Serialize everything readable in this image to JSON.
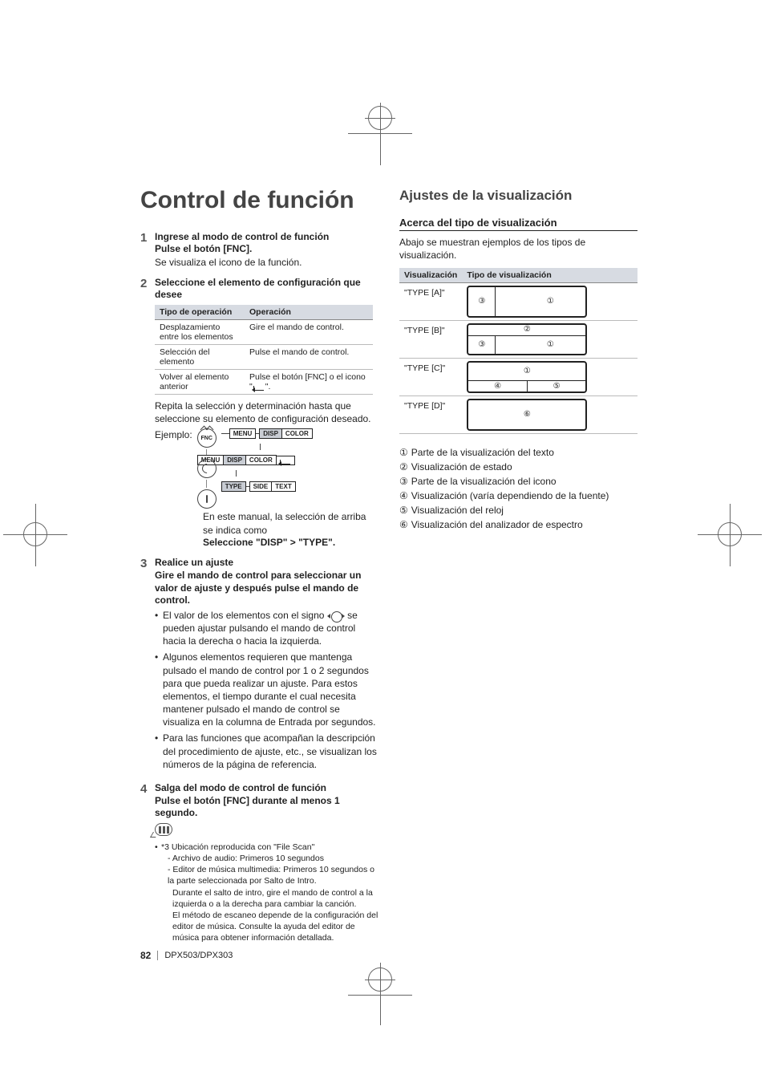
{
  "title": "Control de función",
  "steps": {
    "s1": {
      "num": "1",
      "title": "Ingrese al modo de control de función",
      "sub": "Pulse el botón [FNC].",
      "text": "Se visualiza el icono de la función."
    },
    "s2": {
      "num": "2",
      "title": "Seleccione el elemento de configuración que desee"
    },
    "s3": {
      "num": "3",
      "title": "Realice un ajuste",
      "sub": "Gire el mando de control para seleccionar un valor de ajuste y después pulse el mando de control."
    },
    "s4": {
      "num": "4",
      "title": "Salga del modo de control de función",
      "sub": "Pulse el botón [FNC] durante al menos 1 segundo."
    }
  },
  "op_table": {
    "h1": "Tipo de operación",
    "h2": "Operación",
    "rows": [
      {
        "a": "Desplazamiento entre los elementos",
        "b": "Gire el mando de control."
      },
      {
        "a": "Selección del elemento",
        "b": "Pulse el mando de control."
      },
      {
        "a": "Volver al elemento anterior",
        "b_pre": "Pulse el botón [FNC] o el icono \"",
        "b_post": "\"."
      }
    ]
  },
  "after_table": {
    "line1": "Repita la selección y determinación hasta que seleccione su elemento de configuración deseado.",
    "ej": "Ejemplo:"
  },
  "tree": {
    "fnc": "FNC",
    "menu": "MENU",
    "disp": "DISP",
    "color": "COLOR",
    "type": "TYPE",
    "side": "SIDE",
    "text": "TEXT"
  },
  "after_tree": {
    "line": "En este manual, la selección de arriba se indica como",
    "bold": "Seleccione \"DISP\" > \"TYPE\"."
  },
  "bullets3": {
    "b1a": "El valor de los elementos con el signo ",
    "b1b": " se pueden ajustar pulsando el mando de control hacia la derecha o hacia la izquierda.",
    "b2": "Algunos elementos requieren que mantenga pulsado el mando de control por 1 o 2 segundos para que pueda realizar un ajuste. Para estos elementos, el tiempo durante el cual necesita mantener pulsado el mando de control se visualiza en la columna de Entrada por segundos.",
    "b3": "Para las funciones que acompañan la descripción del procedimiento de ajuste, etc., se visualizan los números de la página de referencia."
  },
  "notes": {
    "n1": "*3 Ubicación reproducida con \"File Scan\"",
    "n1a": "- Archivo de audio: Primeros 10 segundos",
    "n1b": "- Editor de música multimedia: Primeros 10 segundos o la parte seleccionada por Salto de Intro.",
    "n1c": "Durante el salto de intro, gire el mando de control a la izquierda o a la derecha para cambiar la canción.",
    "n1d": "El método de escaneo depende de la configuración del editor de música. Consulte la ayuda del editor de música para obtener información detallada."
  },
  "right": {
    "section": "Ajustes de la visualización",
    "sub": "Acerca del tipo de visualización",
    "intro": "Abajo se muestran ejemplos de los tipos de visualización."
  },
  "disp_table": {
    "h1": "Visualización",
    "h2": "Tipo de visualización",
    "rows": [
      {
        "label": "\"TYPE [A]\""
      },
      {
        "label": "\"TYPE [B]\""
      },
      {
        "label": "\"TYPE [C]\""
      },
      {
        "label": "\"TYPE [D]\""
      }
    ]
  },
  "circ": {
    "c1": "①",
    "c2": "②",
    "c3": "③",
    "c4": "④",
    "c5": "⑤",
    "c6": "⑥"
  },
  "legend": {
    "l1": "Parte de la visualización del texto",
    "l2": "Visualización de estado",
    "l3": "Parte de la visualización del icono",
    "l4": "Visualización (varía dependiendo de la fuente)",
    "l5": "Visualización del reloj",
    "l6": "Visualización del analizador de espectro"
  },
  "footer": {
    "page": "82",
    "model": "DPX503/DPX303"
  }
}
